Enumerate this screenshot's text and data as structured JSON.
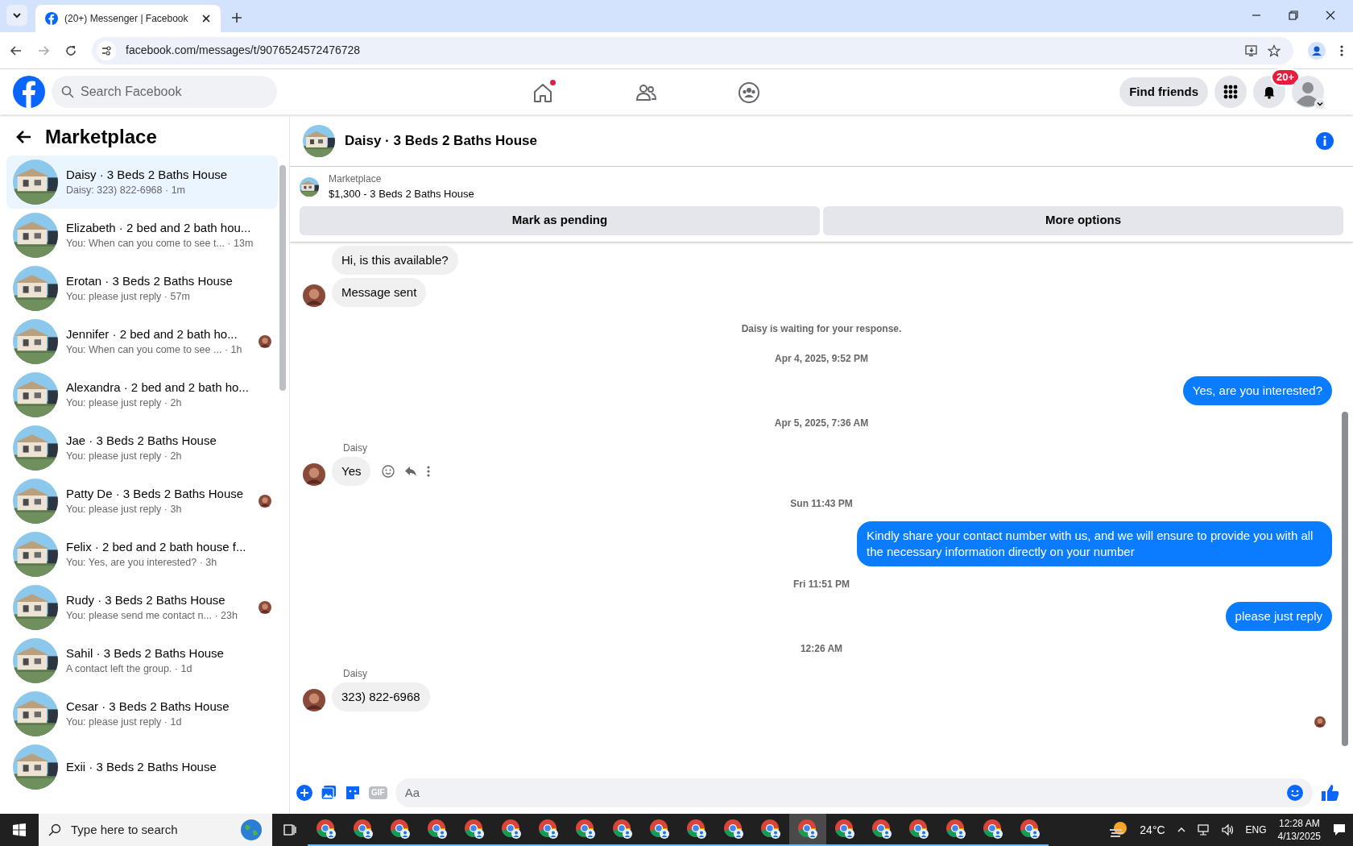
{
  "browser": {
    "tab_title": "(20+) Messenger | Facebook",
    "url": "facebook.com/messages/t/9076524572476728"
  },
  "header": {
    "search_placeholder": "Search Facebook",
    "find_friends": "Find friends",
    "notification_badge": "20+",
    "home_unread": true
  },
  "sidebar": {
    "title": "Marketplace",
    "items": [
      {
        "title": "Daisy · 3 Beds 2 Baths House",
        "preview": "Daisy: 323) 822-6968 · 1m",
        "selected": true,
        "seen": false
      },
      {
        "title": "Elizabeth · 2 bed and 2 bath hou...",
        "preview": "You: When can you come to see t... · 13m",
        "selected": false,
        "seen": false
      },
      {
        "title": "Erotan · 3 Beds 2 Baths House",
        "preview": "You: please just reply · 57m",
        "selected": false,
        "seen": false
      },
      {
        "title": "Jennifer · 2 bed and 2 bath ho...",
        "preview": "You: When can you come to see ... · 1h",
        "selected": false,
        "seen": true
      },
      {
        "title": "Alexandra · 2 bed and 2 bath ho...",
        "preview": "You: please just reply · 2h",
        "selected": false,
        "seen": false
      },
      {
        "title": "Jae · 3 Beds 2 Baths House",
        "preview": "You: please just reply · 2h",
        "selected": false,
        "seen": false
      },
      {
        "title": "Patty De · 3 Beds 2 Baths House",
        "preview": "You: please just reply · 3h",
        "selected": false,
        "seen": true
      },
      {
        "title": "Felix · 2 bed and 2 bath house f...",
        "preview": "You: Yes, are you interested? · 3h",
        "selected": false,
        "seen": false
      },
      {
        "title": "Rudy · 3 Beds 2 Baths House",
        "preview": "You: please send me contact n... · 23h",
        "selected": false,
        "seen": true
      },
      {
        "title": "Sahil · 3 Beds 2 Baths House",
        "preview": "A contact left the group. · 1d",
        "selected": false,
        "seen": false
      },
      {
        "title": "Cesar · 3 Beds 2 Baths House",
        "preview": "You: please just reply · 1d",
        "selected": false,
        "seen": false
      },
      {
        "title": "Exii · 3 Beds 2 Baths House",
        "selected": false,
        "seen": false
      }
    ]
  },
  "chat": {
    "title": "Daisy · 3 Beds 2 Baths House",
    "listing_label": "Marketplace",
    "listing": "$1,300 - 3 Beds 2 Baths House",
    "buttons": [
      "Mark as pending",
      "More options"
    ],
    "messages": [
      {
        "kind": "incoming",
        "text": "Hi, is this available?",
        "avatar": false
      },
      {
        "kind": "incoming",
        "text": "Message sent",
        "avatar": true
      },
      {
        "kind": "notice",
        "text": "Daisy is waiting for your response."
      },
      {
        "kind": "time",
        "text": "Apr 4, 2025, 9:52 PM"
      },
      {
        "kind": "outgoing",
        "text": "Yes, are you interested?"
      },
      {
        "kind": "time",
        "text": "Apr 5, 2025, 7:36 AM"
      },
      {
        "kind": "incoming",
        "sender": "Daisy",
        "text": "Yes",
        "avatar": true,
        "actions": true
      },
      {
        "kind": "time",
        "text": "Sun 11:43 PM"
      },
      {
        "kind": "outgoing",
        "text": "Kindly share your contact number with us, and we will ensure to provide you with all the necessary information directly on your number"
      },
      {
        "kind": "time",
        "text": "Fri 11:51 PM"
      },
      {
        "kind": "outgoing",
        "text": "please just reply"
      },
      {
        "kind": "time",
        "text": "12:26 AM"
      },
      {
        "kind": "incoming",
        "sender": "Daisy",
        "text": "323) 822-6968",
        "avatar": true
      }
    ],
    "seen": true,
    "composer_placeholder": "Aa",
    "gif": "GIF"
  },
  "taskbar": {
    "search_placeholder": "Type here to search",
    "apps": [
      {
        "selected": false
      },
      {
        "selected": false
      },
      {
        "selected": false
      },
      {
        "selected": false
      },
      {
        "selected": false
      },
      {
        "selected": false
      },
      {
        "selected": false
      },
      {
        "selected": false
      },
      {
        "selected": false
      },
      {
        "selected": false
      },
      {
        "selected": false
      },
      {
        "selected": false
      },
      {
        "selected": false
      },
      {
        "selected": true
      },
      {
        "selected": false
      },
      {
        "selected": false
      },
      {
        "selected": false
      },
      {
        "selected": false
      },
      {
        "selected": false
      },
      {
        "selected": false
      }
    ],
    "temperature": "24°C",
    "language": "ENG",
    "time": "12:28 AM",
    "date": "4/13/2025"
  }
}
